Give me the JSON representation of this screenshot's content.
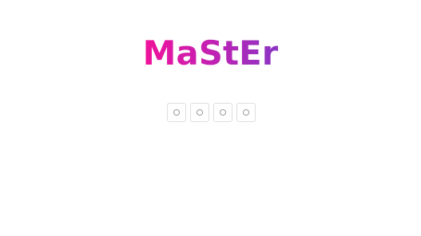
{
  "logo": {
    "text": "MaStEr",
    "colors": [
      "#f0139a",
      "#c81fb0",
      "#8a35c4"
    ]
  },
  "pin": {
    "length": 4,
    "fields": [
      {
        "value": "",
        "placeholder": ""
      },
      {
        "value": "",
        "placeholder": ""
      },
      {
        "value": "",
        "placeholder": ""
      },
      {
        "value": "",
        "placeholder": ""
      }
    ],
    "empty_indicator_icon": "circle-icon"
  }
}
